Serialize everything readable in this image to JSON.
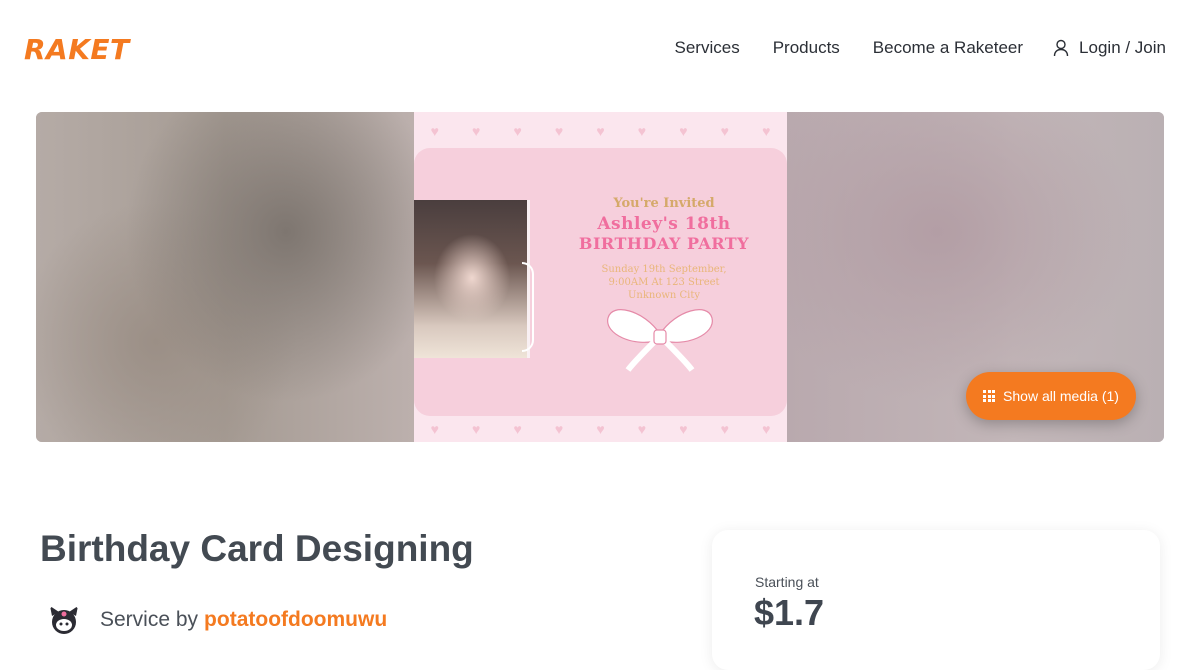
{
  "header": {
    "logo": "RAKET",
    "nav": [
      "Services",
      "Products",
      "Become a Raketeer"
    ],
    "login": "Login / Join"
  },
  "gallery": {
    "card": {
      "line1": "You're Invited",
      "line2": "Ashley's 18th",
      "line3": "BIRTHDAY PARTY",
      "line4": "Sunday 19th September,",
      "line5": "9:00AM At 123 Street",
      "line6": "Unknown City"
    },
    "show_media": "Show all media (1)"
  },
  "listing": {
    "title": "Birthday Card Designing",
    "service_by": "Service by",
    "provider": "potatoofdoomuwu"
  },
  "pricing": {
    "starting_label": "Starting at",
    "price": "$1.7"
  },
  "colors": {
    "brand": "#f47a20"
  }
}
